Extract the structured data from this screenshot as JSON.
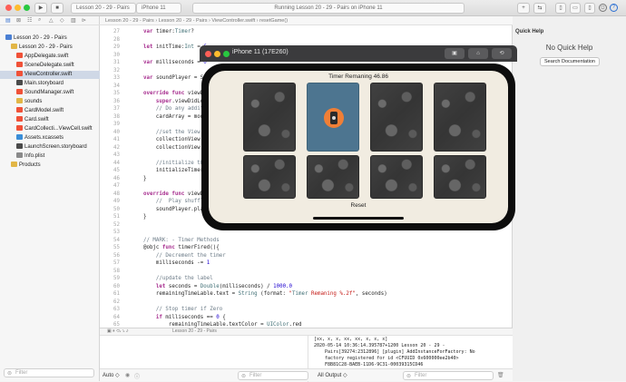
{
  "toolbar": {
    "scheme": "Lesson 20 - 29 - Pairs",
    "device": "iPhone 11",
    "status": "Running Lesson 20 - 29 - Pairs on iPhone 11",
    "colors": {
      "close": "#fe5f57",
      "min": "#febc2e",
      "max": "#28c840"
    }
  },
  "navigator": {
    "items": [
      {
        "label": "Lesson 20 - 29 - Pairs",
        "indent": 1,
        "icon": "project-icon",
        "color": "#4a7fd3",
        "selected": false
      },
      {
        "label": "Lesson 20 - 29 - Pairs",
        "indent": 2,
        "icon": "folder-icon",
        "color": "#e2b646",
        "selected": false
      },
      {
        "label": "AppDelegate.swift",
        "indent": 3,
        "icon": "swift-file-icon",
        "color": "#f05138",
        "selected": false
      },
      {
        "label": "SceneDelegate.swift",
        "indent": 3,
        "icon": "swift-file-icon",
        "color": "#f05138",
        "selected": false
      },
      {
        "label": "ViewController.swift",
        "indent": 3,
        "icon": "swift-file-icon",
        "color": "#f05138",
        "selected": true
      },
      {
        "label": "Main.storyboard",
        "indent": 3,
        "icon": "storyboard-icon",
        "color": "#4a4a4a",
        "selected": false
      },
      {
        "label": "SoundManager.swift",
        "indent": 3,
        "icon": "swift-file-icon",
        "color": "#f05138",
        "selected": false
      },
      {
        "label": "sounds",
        "indent": 3,
        "icon": "folder-icon",
        "color": "#e2b646",
        "selected": false
      },
      {
        "label": "CardModel.swift",
        "indent": 3,
        "icon": "swift-file-icon",
        "color": "#f05138",
        "selected": false
      },
      {
        "label": "Card.swift",
        "indent": 3,
        "icon": "swift-file-icon",
        "color": "#f05138",
        "selected": false
      },
      {
        "label": "CardCollecti...ViewCell.swift",
        "indent": 3,
        "icon": "swift-file-icon",
        "color": "#f05138",
        "selected": false
      },
      {
        "label": "Assets.xcassets",
        "indent": 3,
        "icon": "assets-icon",
        "color": "#3b8ed8",
        "selected": false
      },
      {
        "label": "LaunchScreen.storyboard",
        "indent": 3,
        "icon": "storyboard-icon",
        "color": "#4a4a4a",
        "selected": false
      },
      {
        "label": "Info.plist",
        "indent": 3,
        "icon": "plist-icon",
        "color": "#8a8a8a",
        "selected": false
      },
      {
        "label": "Products",
        "indent": 2,
        "icon": "folder-icon",
        "color": "#e2b646",
        "selected": false
      }
    ],
    "filter_placeholder": "Filter"
  },
  "editor": {
    "jumpbar": "Lesson 20 - 29 - Pairs  ›  Lesson 20 - 29 - Pairs  ›  ViewController.swift  ›  resetGame()",
    "lines": [
      {
        "n": "27",
        "t": "    var timer:Timer?"
      },
      {
        "n": "28",
        "t": ""
      },
      {
        "n": "29",
        "t": "    let initTime:Int = 6"
      },
      {
        "n": "30",
        "t": ""
      },
      {
        "n": "31",
        "t": "    var milliseconds = 0"
      },
      {
        "n": "32",
        "t": ""
      },
      {
        "n": "33",
        "t": "    var soundPlayer = So"
      },
      {
        "n": "34",
        "t": ""
      },
      {
        "n": "35",
        "t": "    override func viewDi"
      },
      {
        "n": "36",
        "t": "        super.viewDidLoa"
      },
      {
        "n": "37",
        "t": "        // Do any additi"
      },
      {
        "n": "38",
        "t": "        cardArray = mode"
      },
      {
        "n": "39",
        "t": ""
      },
      {
        "n": "40",
        "t": "        //set the View c"
      },
      {
        "n": "41",
        "t": "        collectionView.d"
      },
      {
        "n": "42",
        "t": "        collectionView.d"
      },
      {
        "n": "43",
        "t": ""
      },
      {
        "n": "44",
        "t": "        //initialize the"
      },
      {
        "n": "45",
        "t": "        initializeTimer("
      },
      {
        "n": "46",
        "t": "    }"
      },
      {
        "n": "47",
        "t": ""
      },
      {
        "n": "48",
        "t": "    override func viewDi"
      },
      {
        "n": "49",
        "t": "        //  Play shuffle"
      },
      {
        "n": "50",
        "t": "        soundPlayer.play"
      },
      {
        "n": "51",
        "t": "    }"
      },
      {
        "n": "52",
        "t": ""
      },
      {
        "n": "53",
        "t": ""
      },
      {
        "n": "54",
        "t": "    // MARK: - Timer Methods"
      },
      {
        "n": "55",
        "t": "    @objc func timerFired(){"
      },
      {
        "n": "56",
        "t": "        // Decrement the timer"
      },
      {
        "n": "57",
        "t": "        milliseconds -= 1"
      },
      {
        "n": "58",
        "t": ""
      },
      {
        "n": "59",
        "t": "        //update the label"
      },
      {
        "n": "60",
        "t": "        let seconds = Double(milliseconds) / 1000.0"
      },
      {
        "n": "61",
        "t": "        remainingTimeLable.text = String (format: \"Timer Remaning %.2f\", seconds)"
      },
      {
        "n": "62",
        "t": ""
      },
      {
        "n": "63",
        "t": "        // Stop timer if Zero"
      },
      {
        "n": "64",
        "t": "        if milliseconds == 0 {"
      },
      {
        "n": "65",
        "t": "            remainingTimeLable.textColor = UIColor.red"
      }
    ],
    "debug_bar": "Lesson 20 - 29 - Pairs",
    "console": [
      "[xx, x, x, xx, xx, x, x, x]",
      "2020-05-14 10:36:14.395787+1200 Lesson 20 - 29 -",
      "    Pairs[39274:2312896] [plugin] AddInstanceForFactory: No",
      "    factory registered for id <CFUUID 0x600000ee2b40>",
      "    F8B81C28-BAEB-11D6-9C31-00039315CD46"
    ],
    "auto_label": "Auto ◇",
    "filter_placeholder": "Filter",
    "output_label": "All Output ◇",
    "filter2_placeholder": "Filter"
  },
  "inspector": {
    "title": "Quick Help",
    "message": "No Quick Help",
    "button": "Search Documentation"
  },
  "simulator": {
    "title": "iPhone 11 (17E260)",
    "timer_label": "Timer Remaning 46.86",
    "reset_label": "Reset",
    "card_back_color": "#3a3a3a",
    "card_front_color": "#4d7590",
    "icon_color": "#f07f36",
    "cards": [
      {
        "face": "down"
      },
      {
        "face": "up"
      },
      {
        "face": "down"
      },
      {
        "face": "down"
      },
      {
        "face": "down"
      },
      {
        "face": "down"
      },
      {
        "face": "down"
      },
      {
        "face": "down"
      }
    ]
  }
}
